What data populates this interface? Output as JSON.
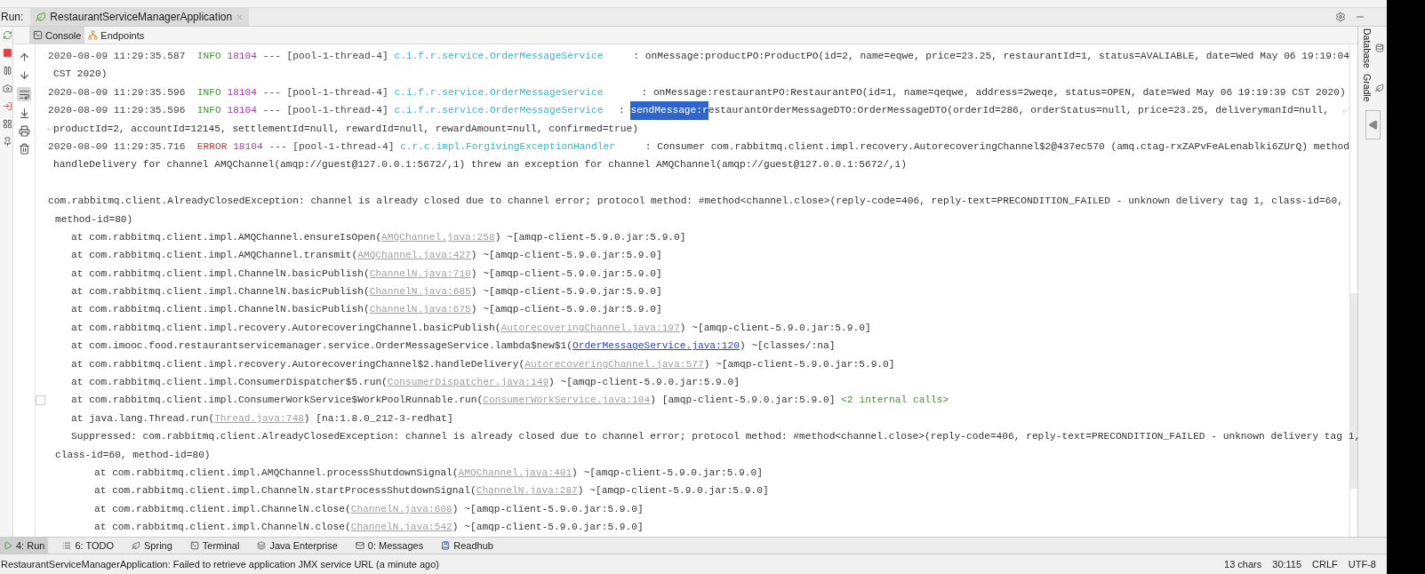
{
  "run_bar": {
    "label": "Run:",
    "tab_title": "RestaurantServiceManagerApplication"
  },
  "console_tabs": [
    {
      "label": "Console",
      "kind": "console",
      "selected": true
    },
    {
      "label": "Endpoints",
      "kind": "endpoints",
      "selected": false
    }
  ],
  "console_lines": [
    {
      "kind": "log",
      "timestamp": "2020-08-09 11:29:35.587",
      "level": "INFO",
      "pid": "18104",
      "sep": "---",
      "thread": "[pool-1-thread-4]",
      "logger": "c.i.f.r.service.OrderMessageService",
      "message": ": onMessage:productPO:ProductPO(id=2, name=eqwe, price=23.25, restaurantId=1, status=AVALIABLE, date=Wed May 06 19:19:04"
    },
    {
      "kind": "cont",
      "text": "CST 2020)"
    },
    {
      "kind": "log",
      "timestamp": "2020-08-09 11:29:35.596",
      "level": "INFO",
      "pid": "18104",
      "sep": "---",
      "thread": "[pool-1-thread-4]",
      "logger": "c.i.f.r.service.OrderMessageService",
      "message": ": onMessage:restaurantPO:RestaurantPO(id=1, name=qeqwe, address=2weqe, status=OPEN, date=Wed May 06 19:19:39 CST 2020)"
    },
    {
      "kind": "log",
      "timestamp": "2020-08-09 11:29:35.596",
      "level": "INFO",
      "pid": "18104",
      "sep": "---",
      "thread": "[pool-1-thread-4]",
      "logger": "c.i.f.r.service.OrderMessageService",
      "prefix": ": ",
      "selection": "sendMessage:r",
      "message": "estaurantOrderMessageDTO:OrderMessageDTO(orderId=286, orderStatus=null, price=23.25, deliverymanId=null,",
      "wrapped": true
    },
    {
      "kind": "cont",
      "text": "productId=2, accountId=12145, settlementId=null, rewardId=null, rewardAmount=null, confirmed=true)",
      "wrapped": true
    },
    {
      "kind": "log",
      "timestamp": "2020-08-09 11:29:35.716",
      "level": "ERROR",
      "pid": "18104",
      "sep": "---",
      "thread": "[pool-1-thread-4]",
      "logger": "c.r.c.impl.ForgivingExceptionHandler",
      "message": ": Consumer com.rabbitmq.client.impl.recovery.AutorecoveringChannel$2@437ec570 (amq.ctag-rxZAPvFeALenablki6ZUrQ) method"
    },
    {
      "kind": "cont",
      "text": "handleDelivery for channel AMQChannel(amqp://guest@127.0.0.1:5672/,1) threw an exception for channel AMQChannel(amqp://guest@127.0.0.1:5672/,1)"
    },
    {
      "kind": "blank"
    },
    {
      "kind": "exception",
      "text": "com.rabbitmq.client.AlreadyClosedException: channel is already closed due to channel error; protocol method: #method<channel.close>(reply-code=406, reply-text=PRECONDITION_FAILED - unknown delivery tag 1, class-id=60,",
      "continuation": "method-id=80)",
      "children": [
        {
          "text": "at com.rabbitmq.client.impl.AMQChannel.ensureIsOpen(",
          "link": "AMQChannel.java:258",
          "own": false,
          "suffix": ") ~[amqp-client-5.9.0.jar:5.9.0]"
        },
        {
          "text": "at com.rabbitmq.client.impl.AMQChannel.transmit(",
          "link": "AMQChannel.java:427",
          "own": false,
          "suffix": ") ~[amqp-client-5.9.0.jar:5.9.0]"
        },
        {
          "text": "at com.rabbitmq.client.impl.ChannelN.basicPublish(",
          "link": "ChannelN.java:710",
          "own": false,
          "suffix": ") ~[amqp-client-5.9.0.jar:5.9.0]"
        },
        {
          "text": "at com.rabbitmq.client.impl.ChannelN.basicPublish(",
          "link": "ChannelN.java:685",
          "own": false,
          "suffix": ") ~[amqp-client-5.9.0.jar:5.9.0]"
        },
        {
          "text": "at com.rabbitmq.client.impl.ChannelN.basicPublish(",
          "link": "ChannelN.java:675",
          "own": false,
          "suffix": ") ~[amqp-client-5.9.0.jar:5.9.0]"
        },
        {
          "text": "at com.rabbitmq.client.impl.recovery.AutorecoveringChannel.basicPublish(",
          "link": "AutorecoveringChannel.java:197",
          "own": false,
          "suffix": ") ~[amqp-client-5.9.0.jar:5.9.0]"
        },
        {
          "text": "at com.imooc.food.restaurantservicemanager.service.OrderMessageService.lambda$new$1(",
          "link": "OrderMessageService.java:120",
          "own": true,
          "suffix": ") ~[classes/:na]"
        },
        {
          "text": "at com.rabbitmq.client.impl.recovery.AutorecoveringChannel$2.handleDelivery(",
          "link": "AutorecoveringChannel.java:577",
          "own": false,
          "suffix": ") ~[amqp-client-5.9.0.jar:5.9.0]"
        },
        {
          "text": "at com.rabbitmq.client.impl.ConsumerDispatcher$5.run(",
          "link": "ConsumerDispatcher.java:149",
          "own": false,
          "suffix": ") ~[amqp-client-5.9.0.jar:5.9.0]"
        },
        {
          "text": "at com.rabbitmq.client.impl.ConsumerWorkService$WorkPoolRunnable.run(",
          "link": "ConsumerWorkService.java:104",
          "own": false,
          "suffix": ") [amqp-client-5.9.0.jar:5.9.0]",
          "note": "<2 internal calls>"
        },
        {
          "text": "at java.lang.Thread.run(",
          "link": "Thread.java:748",
          "own": false,
          "suffix": ") [na:1.8.0_212-3-redhat]"
        },
        {
          "text": "Suppressed: com.rabbitmq.client.AlreadyClosedException: channel is already closed due to channel error; protocol method: #method<channel.close>(reply-code=406, reply-text=PRECONDITION_FAILED - unknown delivery tag 1,",
          "continuation": "class-id=60, method-id=80)",
          "children": [
            {
              "text": "at com.rabbitmq.client.impl.AMQChannel.processShutdownSignal(",
              "link": "AMQChannel.java:401",
              "own": false,
              "suffix": ") ~[amqp-client-5.9.0.jar:5.9.0]"
            },
            {
              "text": "at com.rabbitmq.client.impl.ChannelN.startProcessShutdownSignal(",
              "link": "ChannelN.java:287",
              "own": false,
              "suffix": ") ~[amqp-client-5.9.0.jar:5.9.0]"
            },
            {
              "text": "at com.rabbitmq.client.impl.ChannelN.close(",
              "link": "ChannelN.java:608",
              "own": false,
              "suffix": ") ~[amqp-client-5.9.0.jar:5.9.0]"
            },
            {
              "text": "at com.rabbitmq.client.impl.ChannelN.close(",
              "link": "ChannelN.java:542",
              "own": false,
              "suffix": ") ~[amqp-client-5.9.0.jar:5.9.0]"
            }
          ]
        }
      ]
    }
  ],
  "side_panels": [
    {
      "label": "Database",
      "kind": "database"
    },
    {
      "label": "Gradle",
      "kind": "gradle"
    }
  ],
  "tool_tabs": [
    {
      "label": "4: Run",
      "kind": "run",
      "selected": true
    },
    {
      "label": "6: TODO",
      "kind": "todo",
      "selected": false
    },
    {
      "label": "Spring",
      "kind": "spring",
      "selected": false
    },
    {
      "label": "Terminal",
      "kind": "terminal",
      "selected": false
    },
    {
      "label": "Java Enterprise",
      "kind": "enterprise",
      "selected": false
    },
    {
      "label": "0: Messages",
      "kind": "messages",
      "selected": false
    },
    {
      "label": "Readhub",
      "kind": "readhub",
      "selected": false
    }
  ],
  "status_bar": {
    "message": "RestaurantServiceManagerApplication: Failed to retrieve application JMX service URL (a minute ago)",
    "items": [
      "13 chars",
      "30:115",
      "CRLF",
      "UTF-8"
    ]
  }
}
